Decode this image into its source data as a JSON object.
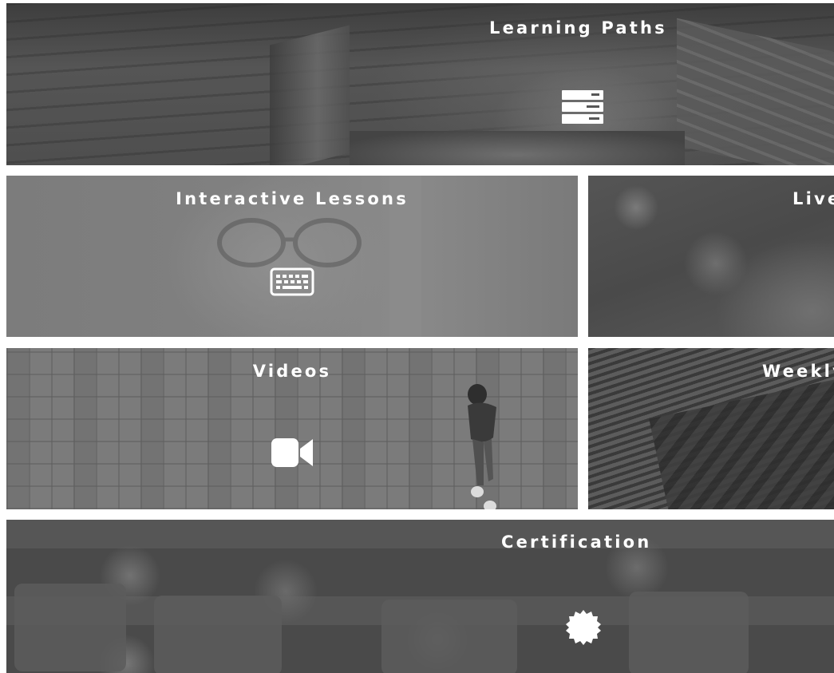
{
  "tiles": {
    "learning_paths": {
      "label": "Learning Paths",
      "icon": "server-stack-icon"
    },
    "interactive_lessons": {
      "label": "Interactive Lessons",
      "icon": "keyboard-icon"
    },
    "live": {
      "label": "Live",
      "icon": ""
    },
    "videos": {
      "label": "Videos",
      "icon": "video-camera-icon"
    },
    "weekly": {
      "label": "Weekly",
      "icon": ""
    },
    "certification": {
      "label": "Certification",
      "icon": "badge-icon"
    }
  },
  "colors": {
    "label": "#ffffff",
    "icon": "#ffffff",
    "gutter": "#ffffff"
  }
}
